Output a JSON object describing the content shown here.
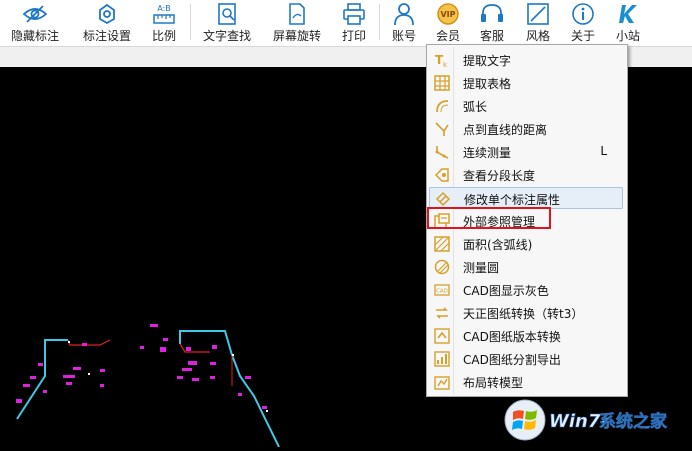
{
  "toolbar": {
    "items": [
      {
        "label": "隐藏标注",
        "icon": "eye-icon"
      },
      {
        "label": "标注设置",
        "icon": "settings-gear-icon"
      },
      {
        "label": "比例",
        "icon": "ruler-scale-icon"
      },
      {
        "label": "文字查找",
        "icon": "text-search-icon"
      },
      {
        "label": "屏幕旋转",
        "icon": "rotate-screen-icon"
      },
      {
        "label": "打印",
        "icon": "printer-icon"
      },
      {
        "label": "账号",
        "icon": "user-account-icon"
      },
      {
        "label": "会员",
        "icon": "vip-icon"
      },
      {
        "label": "客服",
        "icon": "headset-icon"
      },
      {
        "label": "风格",
        "icon": "style-icon"
      },
      {
        "label": "关于",
        "icon": "info-icon"
      },
      {
        "label": "小站",
        "icon": "k-logo-icon"
      }
    ],
    "vip_badge": "VIP",
    "scale_badge": "A:B",
    "colors": {
      "accent": "#1e78c8",
      "vip": "#d89018",
      "k_logo": "#1a8fd0"
    }
  },
  "menu": {
    "items": [
      {
        "label": "提取文字",
        "icon": "extract-text-icon",
        "shortcut": ""
      },
      {
        "label": "提取表格",
        "icon": "extract-table-icon",
        "shortcut": ""
      },
      {
        "label": "弧长",
        "icon": "arc-length-icon",
        "shortcut": ""
      },
      {
        "label": "点到直线的距离",
        "icon": "point-line-distance-icon",
        "shortcut": ""
      },
      {
        "label": "连续测量",
        "icon": "continuous-measure-icon",
        "shortcut": "L"
      },
      {
        "label": "查看分段长度",
        "icon": "segment-length-icon",
        "shortcut": ""
      },
      {
        "label": "修改单个标注属性",
        "icon": "edit-annotation-icon",
        "shortcut": ""
      },
      {
        "label": "外部参照管理",
        "icon": "xref-manage-icon",
        "shortcut": ""
      },
      {
        "label": "面积(含弧线)",
        "icon": "area-icon",
        "shortcut": ""
      },
      {
        "label": "测量圆",
        "icon": "measure-circle-icon",
        "shortcut": ""
      },
      {
        "label": "CAD图显示灰色",
        "icon": "cad-gray-icon",
        "shortcut": ""
      },
      {
        "label": "天正图纸转换（转t3）",
        "icon": "tangent-convert-icon",
        "shortcut": ""
      },
      {
        "label": "CAD图纸版本转换",
        "icon": "cad-version-icon",
        "shortcut": ""
      },
      {
        "label": "CAD图纸分割导出",
        "icon": "cad-split-export-icon",
        "shortcut": ""
      },
      {
        "label": "布局转模型",
        "icon": "layout-to-model-icon",
        "shortcut": ""
      }
    ],
    "hovered_index": 6,
    "highlighted_index": 7,
    "highlight_color": "#e0141e",
    "icon_color": "#d8a02a"
  },
  "watermark": {
    "brand": "Win7",
    "suffix": "系统之家"
  },
  "drawing": {
    "background": "#000000",
    "line_color": "#3ec8e6",
    "annotation_color": "#e020e0",
    "dimension_color": "#e02020"
  }
}
